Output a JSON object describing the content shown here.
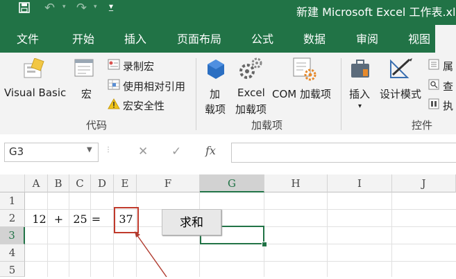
{
  "window": {
    "title": "新建 Microsoft Excel 工作表.xls",
    "accent": "#217346"
  },
  "quick_access": {
    "save_icon": "save-icon",
    "undo_icon": "undo-icon",
    "redo_icon": "redo-icon",
    "customize_icon": "customize-icon"
  },
  "tabs": [
    "文件",
    "开始",
    "插入",
    "页面布局",
    "公式",
    "数据",
    "审阅",
    "视图"
  ],
  "ribbon": {
    "code": {
      "visual_basic": "Visual Basic",
      "macro": "宏",
      "record_macro": "录制宏",
      "relative_ref": "使用相对引用",
      "macro_security": "宏安全性",
      "group_label": "代码"
    },
    "addins": {
      "addins_line1": "加",
      "addins_line2": "载项",
      "excel_addins_line1": "Excel",
      "excel_addins_line2": "加载项",
      "com_addins": "COM 加载项",
      "group_label": "加载项"
    },
    "controls": {
      "insert": "插入",
      "design_mode": "设计模式",
      "properties": "属",
      "view_code": "查",
      "run_dialog": "执",
      "group_label": "控件"
    }
  },
  "formula_bar": {
    "name_box": "G3",
    "cancel": "✕",
    "enter": "✓",
    "fx": "fx",
    "formula": ""
  },
  "columns": [
    "A",
    "B",
    "C",
    "D",
    "E",
    "F",
    "G",
    "H",
    "I",
    "J"
  ],
  "rows": [
    "1",
    "2",
    "3",
    "4",
    "5"
  ],
  "cells": {
    "A2": "12",
    "B2": "+",
    "C2": "25",
    "D2": "=",
    "E2": "37"
  },
  "button": {
    "label": "求和"
  },
  "selected_cell": "G3",
  "highlight_color": "#c0392b"
}
